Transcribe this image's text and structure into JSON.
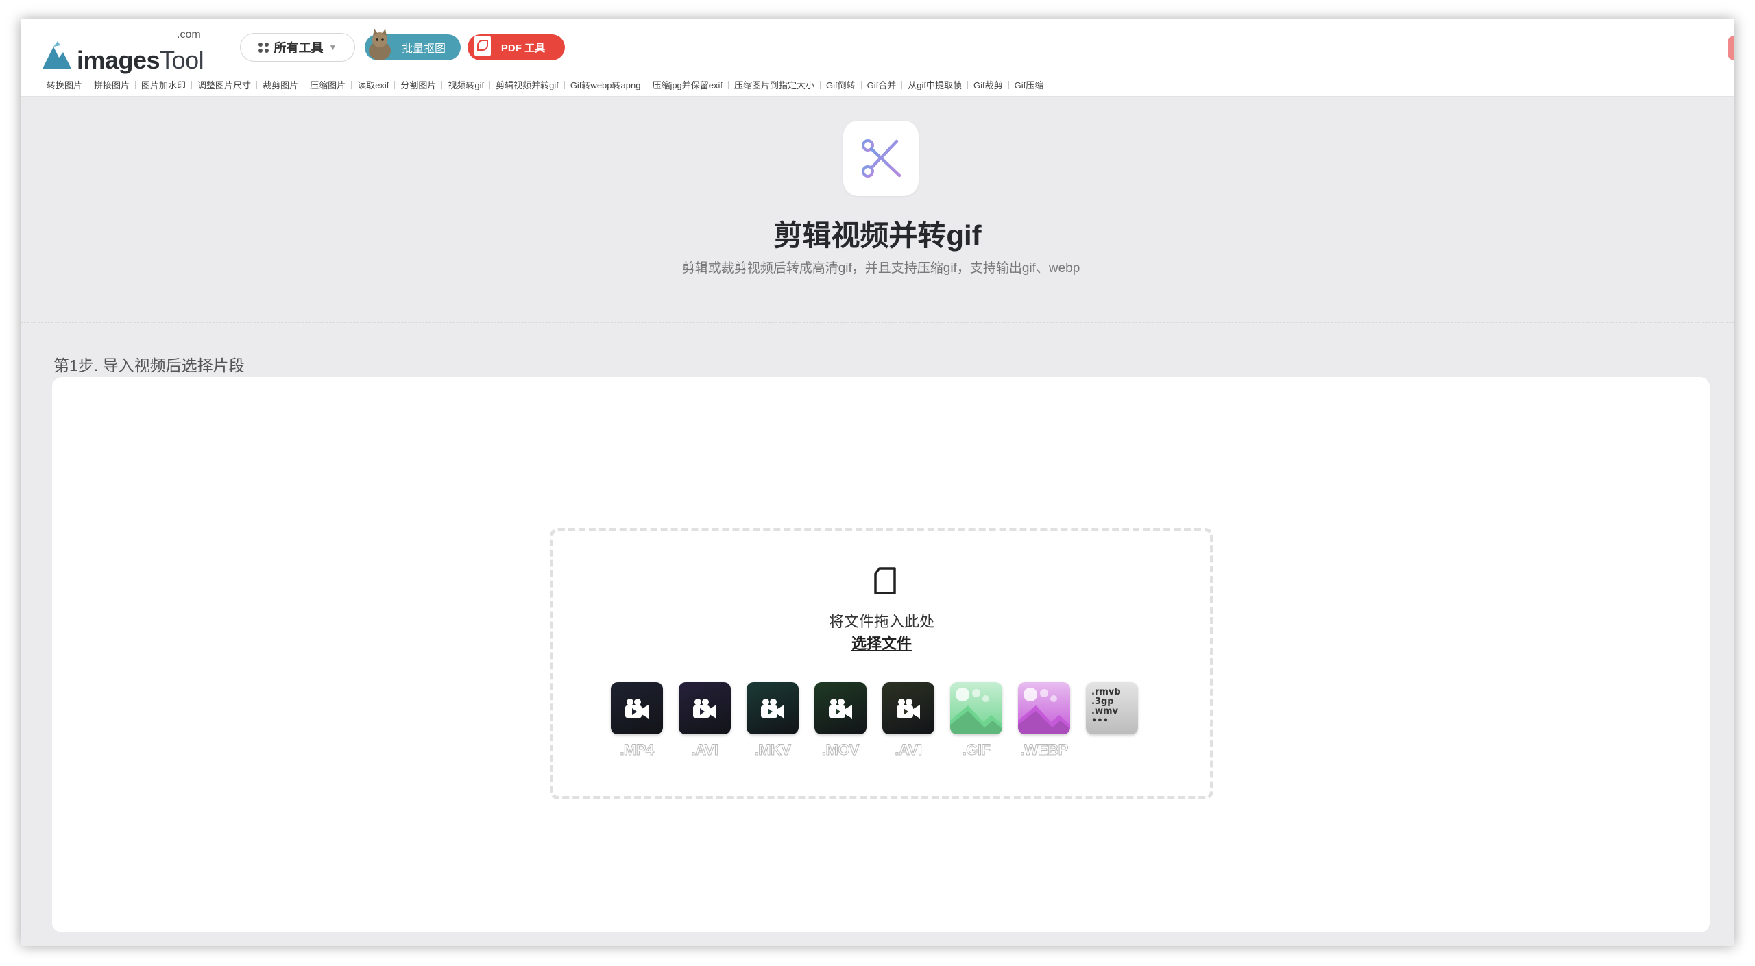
{
  "header": {
    "logo_main": "images",
    "logo_tool": "Tool",
    "logo_com": ".com",
    "all_tools": "所有工具",
    "batch_matting": "批量抠图",
    "pdf_tools": "PDF 工具"
  },
  "toolbar": {
    "items": [
      "转换图片",
      "拼接图片",
      "图片加水印",
      "调整图片尺寸",
      "裁剪图片",
      "压缩图片",
      "读取exif",
      "分割图片",
      "视频转gif",
      "剪辑视频并转gif",
      "Gif转webp转apng",
      "压缩jpg并保留exif",
      "压缩图片到指定大小",
      "Gif倒转",
      "Gif合并",
      "从gif中提取帧",
      "Gif裁剪",
      "Gif压缩"
    ]
  },
  "hero": {
    "title": "剪辑视频并转gif",
    "subtitle": "剪辑或裁剪视频后转成高清gif，并且支持压缩gif，支持输出gif、webp"
  },
  "step": {
    "label": "第1步. 导入视频后选择片段"
  },
  "dropzone": {
    "drop_text": "将文件拖入此处",
    "select_text": "选择文件",
    "formats": [
      {
        "label": ".MP4",
        "kind": "video",
        "color": "#1e2230"
      },
      {
        "label": ".AVI",
        "kind": "video",
        "color": "#26203a"
      },
      {
        "label": ".MKV",
        "kind": "video",
        "color": "#1b3a36"
      },
      {
        "label": ".MOV",
        "kind": "video",
        "color": "#1f3a24"
      },
      {
        "label": ".AVI",
        "kind": "video",
        "color": "#2c3224"
      },
      {
        "label": ".GIF",
        "kind": "image",
        "color": "#6fd48f"
      },
      {
        "label": ".WEBP",
        "kind": "image",
        "color": "#c45ad8"
      },
      {
        "label": ".rmvb\n.3gp\n.wmv\n•••",
        "kind": "other",
        "color": "#cfcfcf"
      }
    ]
  },
  "colors": {
    "accent_blue": "#4a9fb5",
    "accent_red": "#e8453c",
    "page_bg": "#ebebed"
  }
}
